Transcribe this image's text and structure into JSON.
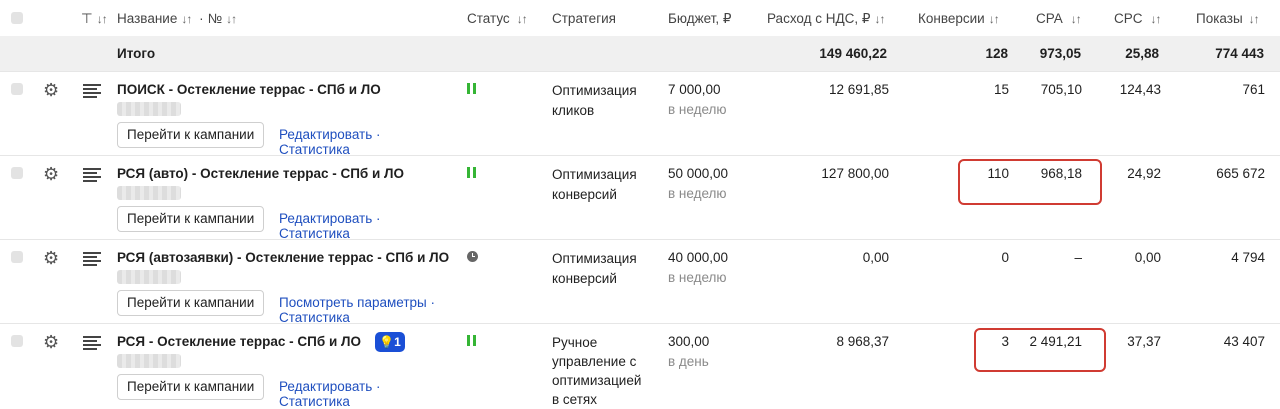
{
  "header": {
    "filter_icon": "⊤",
    "name_label": "Название",
    "name_sep": "·",
    "number_label": "№",
    "status_label": "Статус",
    "strategy_label": "Стратегия",
    "budget_label": "Бюджет, ₽",
    "spend_label": "Расход с НДС, ₽",
    "conversions_label": "Конверсии",
    "cpa_label": "CPA",
    "cpc_label": "CPC",
    "impressions_label": "Показы",
    "sort_glyph": "↓↑"
  },
  "totals": {
    "label": "Итого",
    "spend": "149 460,22",
    "conversions": "128",
    "cpa": "973,05",
    "cpc": "25,88",
    "impressions": "774 443"
  },
  "rows": [
    {
      "name": "ПОИСК - Остекление террас - СПб и ЛО",
      "status": "running",
      "strategy_line1": "Оптимизация",
      "strategy_line2": "кликов",
      "strategy_line3": "",
      "strategy_line4": "",
      "budget": "7 000,00",
      "budget_period": "в неделю",
      "spend": "12 691,85",
      "conversions": "15",
      "cpa": "705,10",
      "cpc": "124,43",
      "impressions": "761",
      "go_button": "Перейти к кампании",
      "link1": "Редактировать",
      "link_sep": "·",
      "link2": "Статистика"
    },
    {
      "name": "РСЯ (авто) - Остекление террас - СПб и ЛО",
      "status": "running",
      "strategy_line1": "Оптимизация",
      "strategy_line2": "конверсий",
      "strategy_line3": "",
      "strategy_line4": "",
      "budget": "50 000,00",
      "budget_period": "в неделю",
      "spend": "127 800,00",
      "conversions": "110",
      "cpa": "968,18",
      "cpc": "24,92",
      "impressions": "665 672",
      "go_button": "Перейти к кампании",
      "link1": "Редактировать",
      "link_sep": "·",
      "link2": "Статистика"
    },
    {
      "name": "РСЯ (автозаявки) - Остекление террас - СПб и ЛО",
      "status": "pending",
      "strategy_line1": "Оптимизация",
      "strategy_line2": "конверсий",
      "strategy_line3": "",
      "strategy_line4": "",
      "budget": "40 000,00",
      "budget_period": "в неделю",
      "spend": "0,00",
      "conversions": "0",
      "cpa": "–",
      "cpc": "0,00",
      "impressions": "4 794",
      "go_button": "Перейти к кампании",
      "link1": "Посмотреть параметры",
      "link_sep": "·",
      "link2": "Статистика"
    },
    {
      "name": "РСЯ - Остекление террас - СПб и ЛО",
      "status": "running",
      "badge": "1",
      "strategy_line1": "Ручное",
      "strategy_line2": "управление с",
      "strategy_line3": "оптимизацией",
      "strategy_line4": "в сетях",
      "budget": "300,00",
      "budget_period": "в день",
      "spend": "8 968,37",
      "conversions": "3",
      "cpa": "2 491,21",
      "cpc": "37,37",
      "impressions": "43 407",
      "go_button": "Перейти к кампании",
      "link1": "Редактировать",
      "link_sep": "·",
      "link2": "Статистика"
    }
  ],
  "colors": {
    "link": "#1f4fbf",
    "status_running": "#35b535",
    "highlight": "#d03b32",
    "badge": "#1a4fd6"
  }
}
